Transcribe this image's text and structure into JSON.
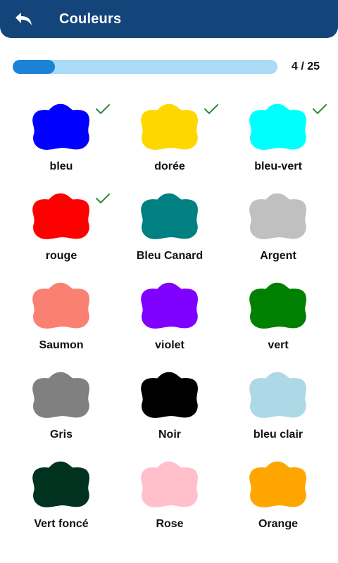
{
  "header": {
    "title": "Couleurs",
    "back_icon": "undo-arrow-icon",
    "background": "#14457a"
  },
  "progress": {
    "current": 4,
    "total": 25,
    "fraction": 0.16,
    "text": "4 / 25",
    "track_color": "#a9daf6",
    "fill_color": "#1b82d6"
  },
  "colors": [
    {
      "label": "bleu",
      "color": "#0000ff",
      "checked": true
    },
    {
      "label": "dorée",
      "color": "#ffd700",
      "checked": true
    },
    {
      "label": "bleu-vert",
      "color": "#00ffff",
      "checked": true
    },
    {
      "label": "rouge",
      "color": "#ff0000",
      "checked": true
    },
    {
      "label": "Bleu Canard",
      "color": "#008080",
      "checked": false
    },
    {
      "label": "Argent",
      "color": "#c0c0c0",
      "checked": false
    },
    {
      "label": "Saumon",
      "color": "#fa8072",
      "checked": false
    },
    {
      "label": "violet",
      "color": "#8000ff",
      "checked": false
    },
    {
      "label": "vert",
      "color": "#008000",
      "checked": false
    },
    {
      "label": "Gris",
      "color": "#808080",
      "checked": false
    },
    {
      "label": "Noir",
      "color": "#000000",
      "checked": false
    },
    {
      "label": "bleu clair",
      "color": "#add8e6",
      "checked": false
    },
    {
      "label": "Vert foncé",
      "color": "#013220",
      "checked": false
    },
    {
      "label": "Rose",
      "color": "#ffc0cb",
      "checked": false
    },
    {
      "label": "Orange",
      "color": "#ffa500",
      "checked": false
    }
  ],
  "check_color": "#2e8b3a"
}
